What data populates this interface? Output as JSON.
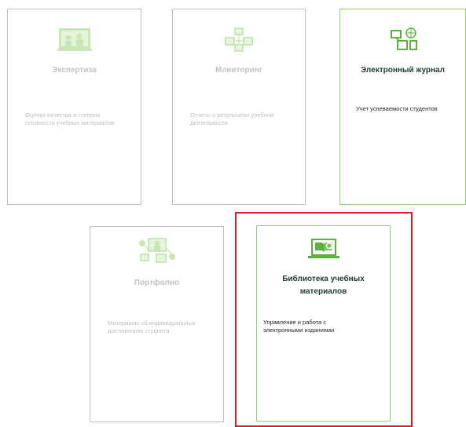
{
  "cards": [
    {
      "title": "Экспертиза",
      "description": "Оценка качества и степени готовности учебных материалов",
      "icon": "expertise-icon",
      "state": "disabled"
    },
    {
      "title": "Мониторинг",
      "description": "Отчеты о результатах учебной деятельности",
      "icon": "monitoring-icon",
      "state": "disabled"
    },
    {
      "title": "Электронный журнал",
      "description": "Учет успеваемости студентов",
      "icon": "journal-icon",
      "state": "active"
    },
    {
      "title": "Портфолио",
      "description": "Материалы об индивидуальных достижениях студента",
      "icon": "portfolio-icon",
      "state": "disabled"
    },
    {
      "title": "Библиотека учебных материалов",
      "description": "Управление и работа с электронными изданиями",
      "icon": "library-icon",
      "state": "active"
    }
  ],
  "colors": {
    "active_border": "#8fd16a",
    "disabled_border": "#bdbdbd",
    "disabled_icon": "#c9e7b6",
    "active_icon": "#58b33b",
    "highlight": "#e01818",
    "active_title": "#1f3e2e"
  }
}
